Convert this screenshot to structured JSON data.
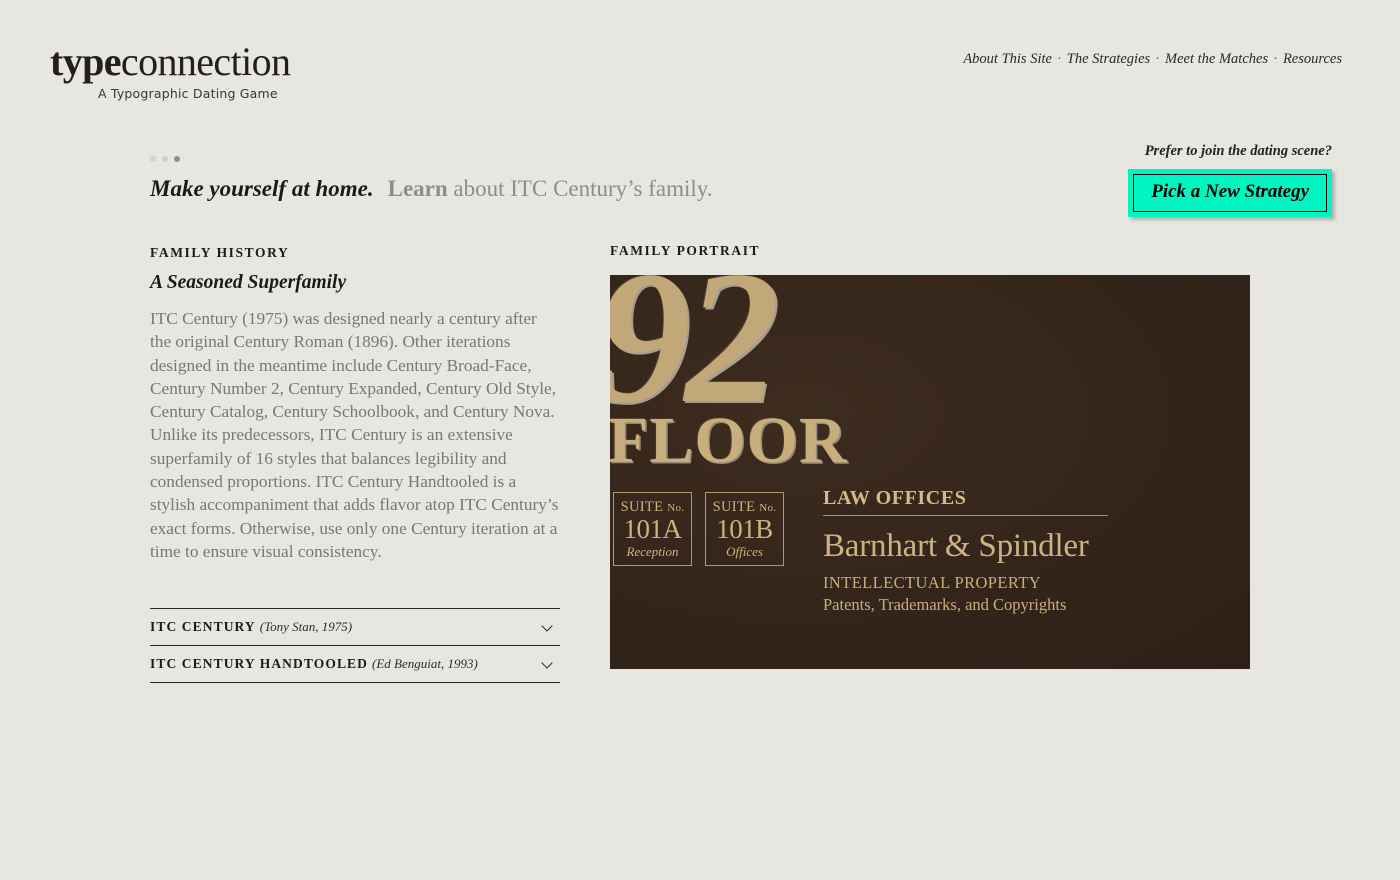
{
  "site": {
    "logo_bold": "type",
    "logo_regular": "connection",
    "tagline": "A Typographic Dating Game"
  },
  "nav": {
    "items": [
      {
        "label": "About This Site"
      },
      {
        "label": "The Strategies"
      },
      {
        "label": "Meet the Matches"
      },
      {
        "label": "Resources"
      }
    ],
    "separator": "·"
  },
  "progress": {
    "total_steps": 3,
    "active_step": 3
  },
  "headline": {
    "strong": "Make yourself at home.",
    "learn": "Learn",
    "rest": "about ITC Century’s family."
  },
  "strategy": {
    "prompt": "Prefer to join the dating scene?",
    "button_label": "Pick a New Strategy",
    "accent_color": "#00f5c0"
  },
  "family_history": {
    "label": "FAMILY HISTORY",
    "title": "A Seasoned Superfamily",
    "body": "ITC Century (1975) was designed nearly a century after the original Century Roman (1896). Other iterations designed in the meantime include Century Broad-Face, Century Number 2, Century Expanded, Century Old Style, Century Catalog, Century Schoolbook, and Century Nova. Unlike its predecessors, ITC Century is an extensive superfamily of 16 styles that balances legibility and condensed proportions. ITC Century Handtooled is a stylish accompaniment that adds flavor atop ITC Century’s exact forms. Otherwise, use only one Century iteration at a time to ensure visual consistency."
  },
  "typefaces": [
    {
      "name": "ITC CENTURY",
      "meta": "(Tony Stan, 1975)"
    },
    {
      "name": "ITC CENTURY HANDTOOLED",
      "meta": "(Ed Benguiat, 1993)"
    }
  ],
  "family_portrait": {
    "label": "FAMILY PORTRAIT",
    "background_color": "#33241a",
    "gold_color": "#cdb383",
    "floor_number": "92",
    "floor_word": "FLOOR",
    "suites": [
      {
        "top": "SUITE",
        "no": "No.",
        "number": "101A",
        "use": "Reception"
      },
      {
        "top": "SUITE",
        "no": "No.",
        "number": "101B",
        "use": "Offices"
      }
    ],
    "law": {
      "heading": "LAW OFFICES",
      "firm": "Barnhart & Spindler",
      "practice": "INTELLECTUAL PROPERTY",
      "services": "Patents, Trademarks, and Copyrights"
    }
  }
}
